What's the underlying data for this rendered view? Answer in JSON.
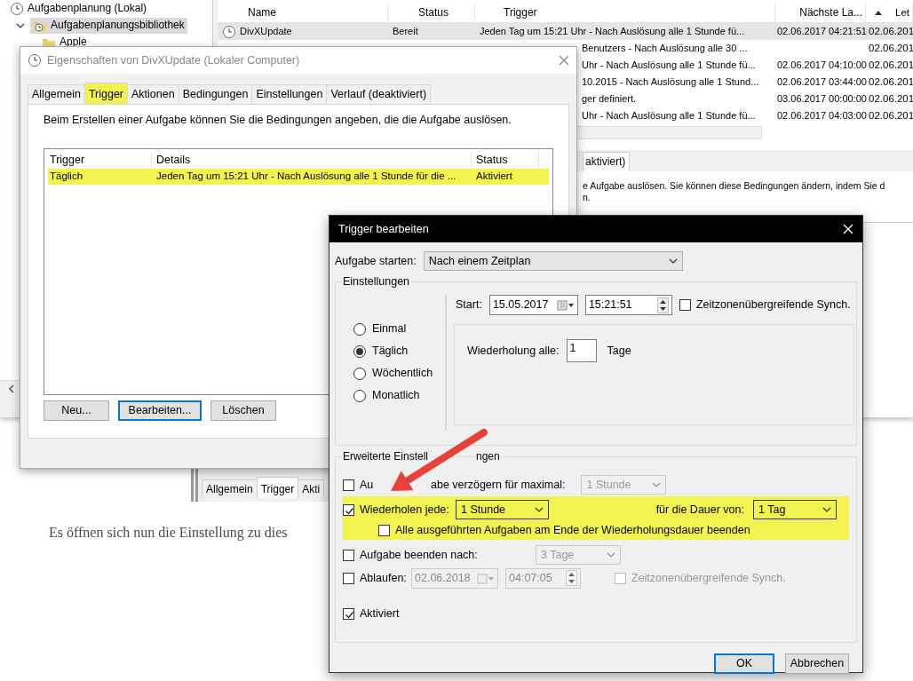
{
  "scheduler": {
    "tree": [
      {
        "label": "Aufgabenplanung (Lokal)",
        "kind": "root",
        "selected": false,
        "children": [
          {
            "label": "Aufgabenplanungsbibliothek",
            "kind": "library",
            "selected": true,
            "expanded": true,
            "children": [
              {
                "label": "Apple",
                "kind": "folder",
                "selected": false
              }
            ]
          }
        ]
      }
    ],
    "task_table": {
      "columns": [
        {
          "label": "Name",
          "sorted": false
        },
        {
          "label": "Status",
          "sorted": false
        },
        {
          "label": "Trigger",
          "sorted": false
        },
        {
          "label": "Nächste La...",
          "sorted": false
        },
        {
          "label": "Let",
          "sorted": true
        }
      ],
      "rows": [
        {
          "name": "DivXUpdate",
          "status": "Bereit",
          "trigger": "Jeden Tag um 15:21 Uhr - Nach Auslösung alle 1 Stunde fü...",
          "next_run": "02.06.2017 04:21:51",
          "last_run": "02.06.201",
          "selected": true
        },
        {
          "trigger": "Benutzers - Nach Auslösung alle 30 ...",
          "last_run": "02.06.201",
          "selected": false
        },
        {
          "trigger": "Uhr - Nach Auslösung alle 1 Stunde fü...",
          "next_run": "02.06.2017 04:10:00",
          "last_run": "02.06.201",
          "selected": false
        },
        {
          "trigger": "10.2015 - Nach Auslösung alle 1 Stund...",
          "next_run": "02.06.2017 03:44:00",
          "last_run": "02.06.201",
          "selected": false
        },
        {
          "trigger": "ger definiert.",
          "next_run": "03.06.2017 00:00:00",
          "last_run": "02.06.201",
          "selected": false
        },
        {
          "trigger": "Uhr - Nach Auslösung alle 1 Stunde fü...",
          "next_run": "02.06.2017 04:03:00",
          "last_run": "02.06.201",
          "selected": false
        }
      ]
    },
    "lower_pane": {
      "tab": "aktiviert)",
      "text_lines": [
        "e Aufgabe auslösen. Sie können diese Bedingungen ändern, indem Sie d",
        "n."
      ]
    }
  },
  "properties_dialog": {
    "title": "Eigenschaften von DivXUpdate (Lokaler Computer)",
    "tabs": [
      {
        "label": "Allgemein",
        "selected": false,
        "highlighted": false
      },
      {
        "label": "Trigger",
        "selected": true,
        "highlighted": true
      },
      {
        "label": "Aktionen",
        "selected": false,
        "highlighted": false
      },
      {
        "label": "Bedingungen",
        "selected": false,
        "highlighted": false
      },
      {
        "label": "Einstellungen",
        "selected": false,
        "highlighted": false
      },
      {
        "label": "Verlauf (deaktiviert)",
        "selected": false,
        "highlighted": false
      }
    ],
    "description": "Beim Erstellen einer Aufgabe können Sie die Bedingungen angeben, die die Aufgabe auslösen.",
    "trigger_table": {
      "columns": [
        "Trigger",
        "Details",
        "Status"
      ],
      "rows": [
        {
          "cells": [
            "Täglich",
            "Jeden Tag um 15:21 Uhr - Nach Auslösung alle 1 Stunde für die ...",
            "Aktiviert"
          ],
          "highlighted": true
        }
      ]
    },
    "buttons": [
      {
        "label": "Neu...",
        "focused": false
      },
      {
        "label": "Bearbeiten...",
        "focused": true
      },
      {
        "label": "Löschen",
        "focused": false
      }
    ]
  },
  "background_tabs": [
    {
      "label": "Allgemein",
      "selected": false
    },
    {
      "label": "Trigger",
      "selected": true
    },
    {
      "label": "Akti",
      "selected": false
    }
  ],
  "article_text": "Es öffnen sich nun die Einstellung zu dies",
  "trigger_dialog": {
    "title": "Trigger bearbeiten",
    "start_label": "Aufgabe starten:",
    "start_value": "Nach einem Zeitplan",
    "settings_legend": "Einstellungen",
    "schedule_options": [
      {
        "label": "Einmal",
        "selected": false
      },
      {
        "label": "Täglich",
        "selected": true
      },
      {
        "label": "Wöchentlich",
        "selected": false
      },
      {
        "label": "Monatlich",
        "selected": false
      }
    ],
    "start": {
      "label": "Start:",
      "date": "15.05.2017",
      "time": "15:21:51",
      "sync": {
        "label": "Zeitzonenübergreifende Synch.",
        "checked": false
      }
    },
    "recur": {
      "label": "Wiederholung alle:",
      "value": "1",
      "unit": "Tage"
    },
    "advanced_legend_parts": [
      "Erweiterte Einstell",
      "ngen"
    ],
    "delay": {
      "label_parts": [
        "Au",
        "abe verzögern für maximal:"
      ],
      "checked": false,
      "value": "1 Stunde"
    },
    "repeat": {
      "label": "Wiederholen jede:",
      "checked": true,
      "value": "1 Stunde",
      "duration_label": "für die Dauer von:",
      "duration": "1 Tag",
      "highlighted": true,
      "stop_all": {
        "label": "Alle ausgeführten Aufgaben am Ende der Wiederholungsdauer beenden",
        "checked": false
      }
    },
    "stop_after": {
      "label": "Aufgabe beenden nach:",
      "checked": false,
      "value": "3 Tage"
    },
    "expire": {
      "label": "Ablaufen:",
      "checked": false,
      "date": "02.06.2018",
      "time": "04:07:05",
      "sync": {
        "label": "Zeitzonenübergreifende Synch.",
        "checked": false
      }
    },
    "enabled": {
      "label": "Aktiviert",
      "checked": true
    },
    "buttons": [
      {
        "label": "OK",
        "default": true
      },
      {
        "label": "Abbrechen",
        "default": false
      }
    ]
  }
}
